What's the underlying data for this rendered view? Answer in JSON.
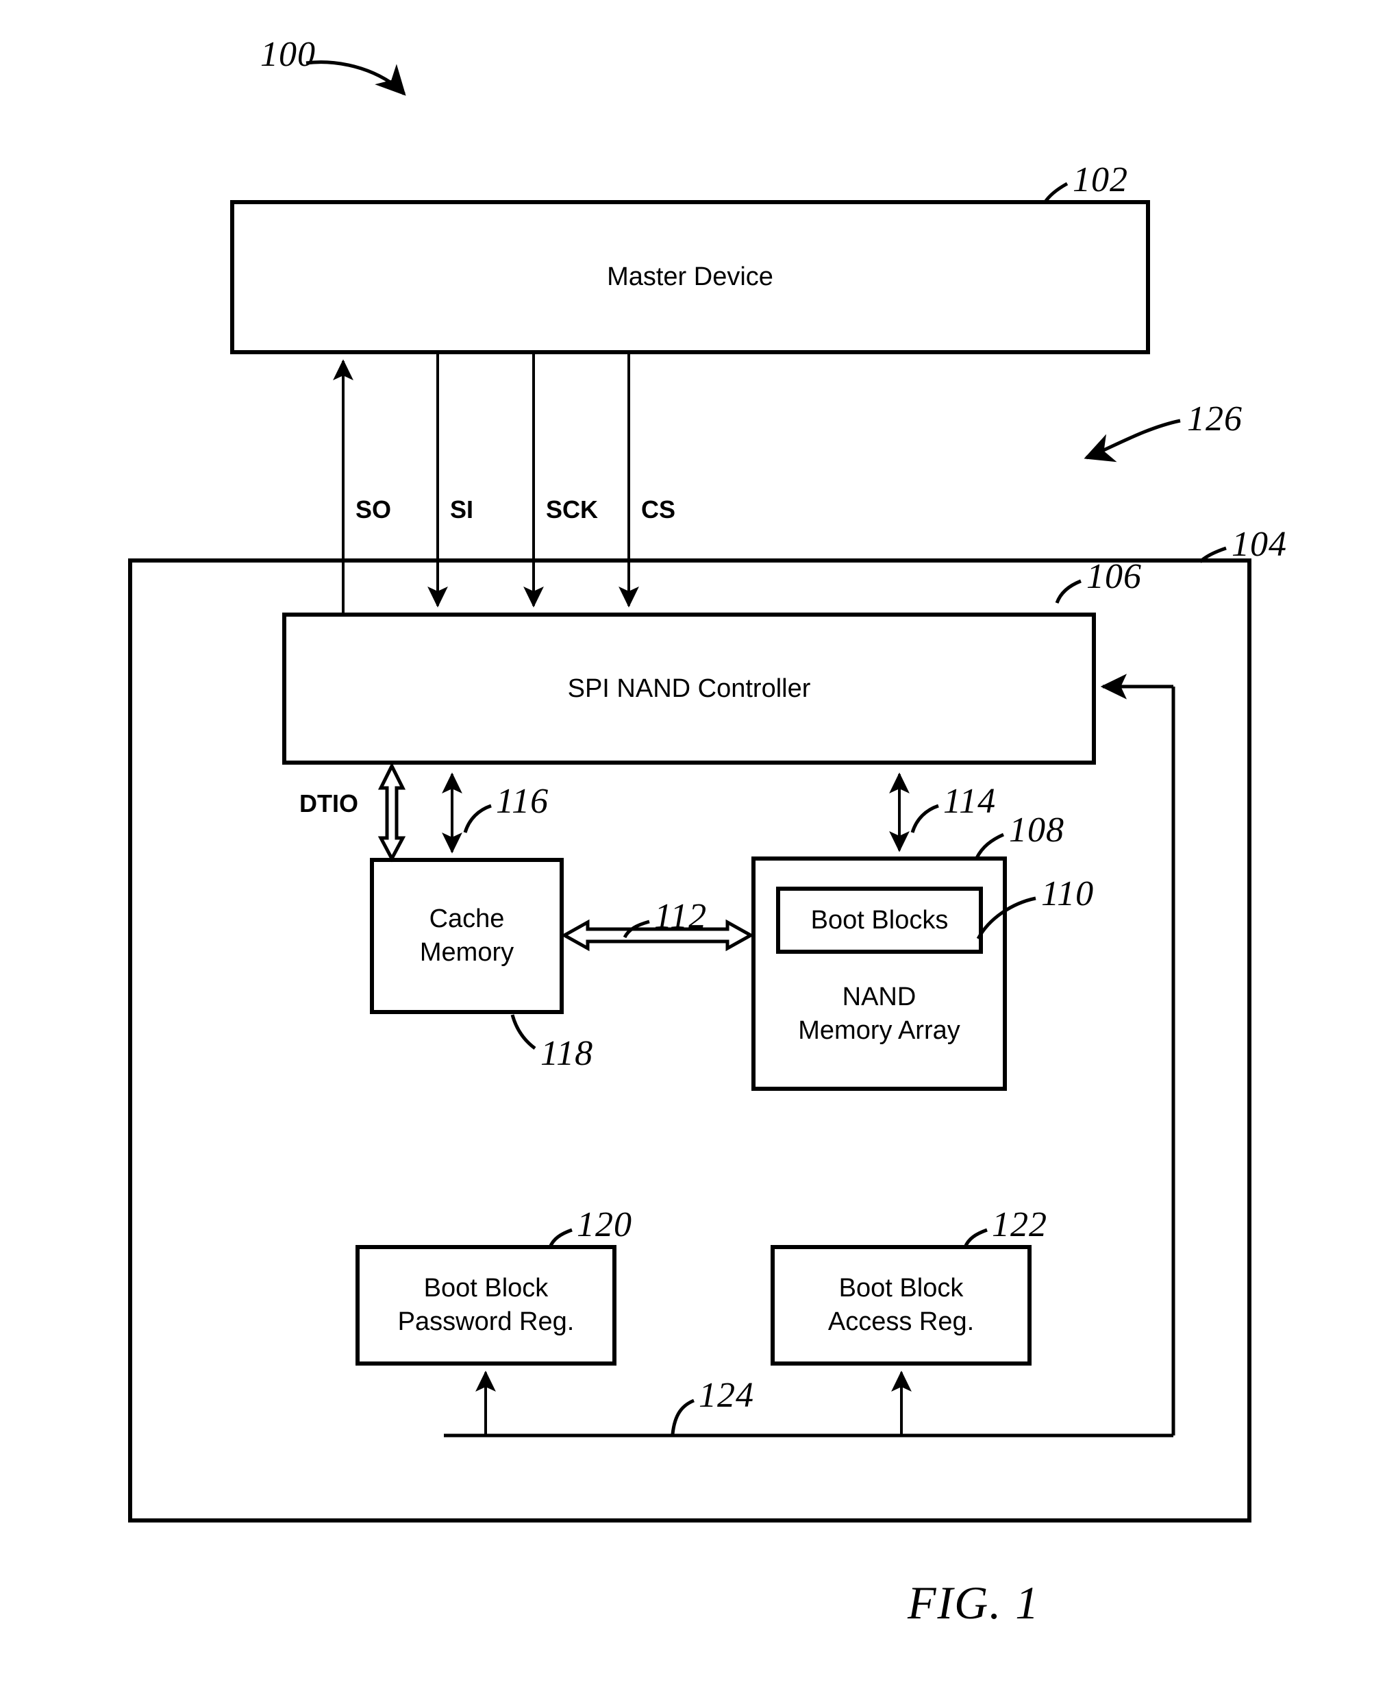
{
  "figure": {
    "caption": "FIG. 1",
    "reference_numeral": "100"
  },
  "blocks": [
    {
      "id": "master_device",
      "label": "Master Device",
      "ref": "102"
    },
    {
      "id": "memory_device",
      "label": "",
      "ref": "104"
    },
    {
      "id": "spi_nand_controller",
      "label": "SPI NAND Controller",
      "ref": "106"
    },
    {
      "id": "nand_memory_array",
      "label": "NAND\nMemory Array",
      "ref": "108"
    },
    {
      "id": "boot_blocks",
      "label": "Boot Blocks",
      "ref": "110"
    },
    {
      "id": "cache_memory",
      "label": "Cache\nMemory",
      "ref": "118"
    },
    {
      "id": "boot_block_password_reg",
      "label": "Boot Block\nPassword Reg.",
      "ref": "120"
    },
    {
      "id": "boot_block_access_reg",
      "label": "Boot Block\nAccess Reg.",
      "ref": "122"
    }
  ],
  "signals": [
    {
      "id": "so",
      "label": "SO",
      "direction": "up"
    },
    {
      "id": "si",
      "label": "SI",
      "direction": "down"
    },
    {
      "id": "sck",
      "label": "SCK",
      "direction": "down"
    },
    {
      "id": "cs",
      "label": "CS",
      "direction": "down"
    }
  ],
  "connections": [
    {
      "id": "spi_bus",
      "ref": "126",
      "label": ""
    },
    {
      "id": "dtio_bus",
      "ref": "",
      "label": "DTIO"
    },
    {
      "id": "cache_controller_bus",
      "ref": "116",
      "label": ""
    },
    {
      "id": "array_controller_bus",
      "ref": "114",
      "label": ""
    },
    {
      "id": "cache_array_bus",
      "ref": "112",
      "label": ""
    },
    {
      "id": "register_bus",
      "ref": "124",
      "label": ""
    }
  ],
  "reference_numerals": {
    "n100": "100",
    "n102": "102",
    "n104": "104",
    "n106": "106",
    "n108": "108",
    "n110": "110",
    "n112": "112",
    "n114": "114",
    "n116": "116",
    "n118": "118",
    "n120": "120",
    "n122": "122",
    "n124": "124",
    "n126": "126"
  },
  "labels": {
    "master_device": "Master Device",
    "spi_nand_controller": "SPI NAND Controller",
    "cache_memory": "Cache\nMemory",
    "nand_memory_array": "NAND\nMemory Array",
    "boot_blocks": "Boot Blocks",
    "boot_block_password_reg": "Boot Block\nPassword Reg.",
    "boot_block_access_reg": "Boot Block\nAccess Reg.",
    "dtio": "DTIO",
    "so": "SO",
    "si": "SI",
    "sck": "SCK",
    "cs": "CS",
    "fig_caption": "FIG. 1"
  },
  "colors": {
    "line": "#000000",
    "background": "#ffffff"
  }
}
